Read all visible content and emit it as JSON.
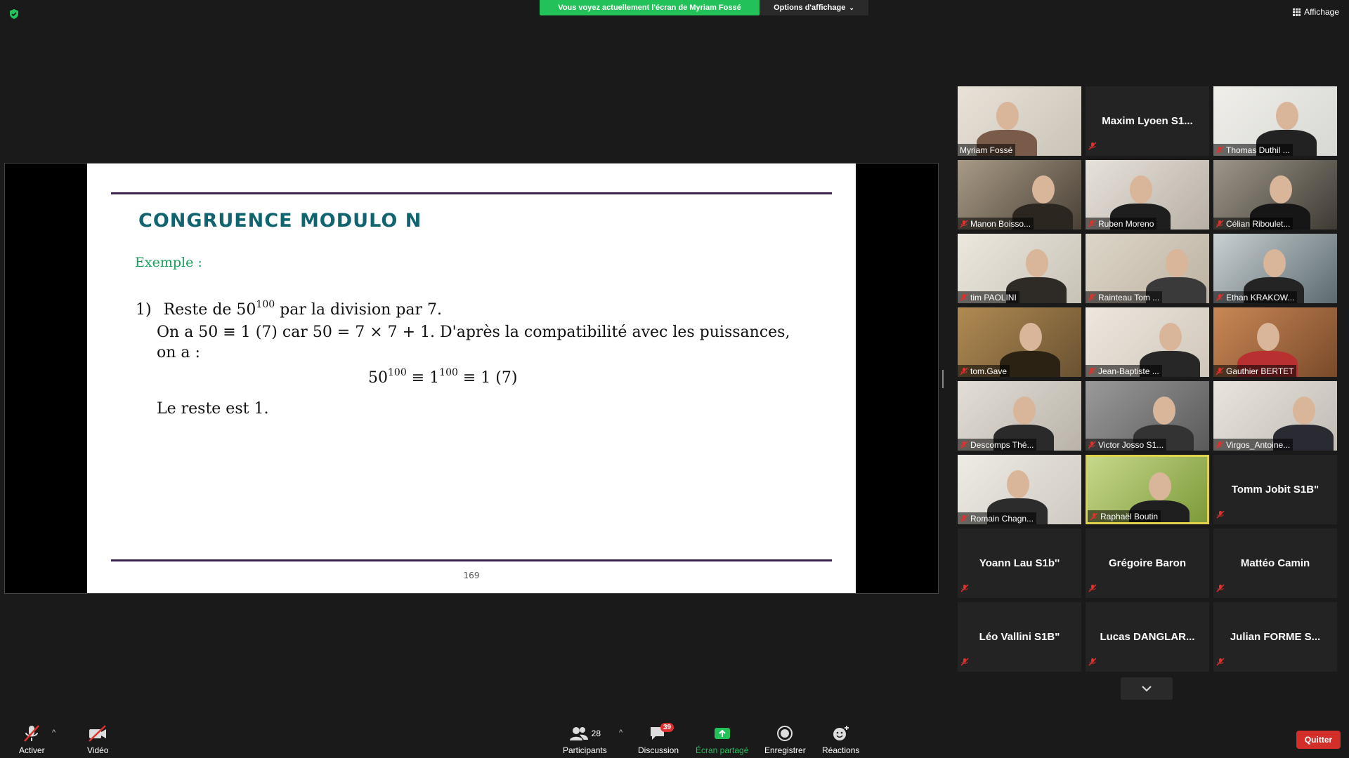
{
  "top": {
    "share_banner": "Vous voyez actuellement l'écran de Myriam Fossé",
    "view_options": "Options d'affichage",
    "affichage": "Affichage"
  },
  "slide": {
    "title": "CONGRUENCE MODULO N",
    "exemple": "Exemple :",
    "item_number": "1)",
    "line1_a": "Reste de 50",
    "line1_sup": "100",
    "line1_b": " par la division par 7.",
    "line2": "On a 50 ≡ 1 (7) car 50 = 7 × 7 + 1. D'après la compatibilité avec les puissances,",
    "line3": "on a :",
    "eq_a": "50",
    "eq_sup1": "100",
    "eq_b": " ≡ 1",
    "eq_sup2": "100",
    "eq_c": " ≡ 1 (7)",
    "line5": "Le reste est 1.",
    "page_number": "169"
  },
  "participants": [
    {
      "name": "Myriam Fossé",
      "video": true
    },
    {
      "name": "Maxim  Lyoen  S1...",
      "video": false
    },
    {
      "name": "Thomas Duthil ...",
      "video": true
    },
    {
      "name": "Manon Boisso...",
      "video": true
    },
    {
      "name": "Ruben Moreno",
      "video": true
    },
    {
      "name": "Célian Riboulet...",
      "video": true
    },
    {
      "name": "tim PAOLINI",
      "video": true
    },
    {
      "name": "Rainteau Tom ...",
      "video": true
    },
    {
      "name": "Ethan KRAKOW...",
      "video": true
    },
    {
      "name": "tom.Gave",
      "video": true
    },
    {
      "name": "Jean-Baptiste ...",
      "video": true
    },
    {
      "name": "Gauthier BERTET",
      "video": true
    },
    {
      "name": "Descomps Thé...",
      "video": true
    },
    {
      "name": "Victor Josso S1...",
      "video": true
    },
    {
      "name": "Virgos_Antoine...",
      "video": true
    },
    {
      "name": "Romain Chagn...",
      "video": true
    },
    {
      "name": "Raphaël Boutin",
      "video": true
    },
    {
      "name": "Tomm Jobit S1B\"",
      "video": false
    },
    {
      "name": "Yoann Lau S1b''",
      "video": false
    },
    {
      "name": "Grégoire Baron",
      "video": false
    },
    {
      "name": "Mattéo Camin",
      "video": false
    },
    {
      "name": "Léo Vallini S1B\"",
      "video": false
    },
    {
      "name": "Lucas  DANGLAR...",
      "video": false
    },
    {
      "name": "Julian  FORME  S...",
      "video": false
    }
  ],
  "toolbar": {
    "mic_label": "Activer",
    "video_label": "Vidéo",
    "participants_label": "Participants",
    "participants_count": "28",
    "chat_label": "Discussion",
    "chat_badge": "39",
    "share_label": "Écran partagé",
    "record_label": "Enregistrer",
    "reactions_label": "Réactions",
    "quit_label": "Quitter"
  },
  "colors": {
    "share_green": "#23c15a",
    "slide_title": "#0f6470",
    "exemple_green": "#18a05a",
    "rule": "#3d2450",
    "quit_red": "#d22f2b",
    "active_speaker": "#e0d24a"
  }
}
